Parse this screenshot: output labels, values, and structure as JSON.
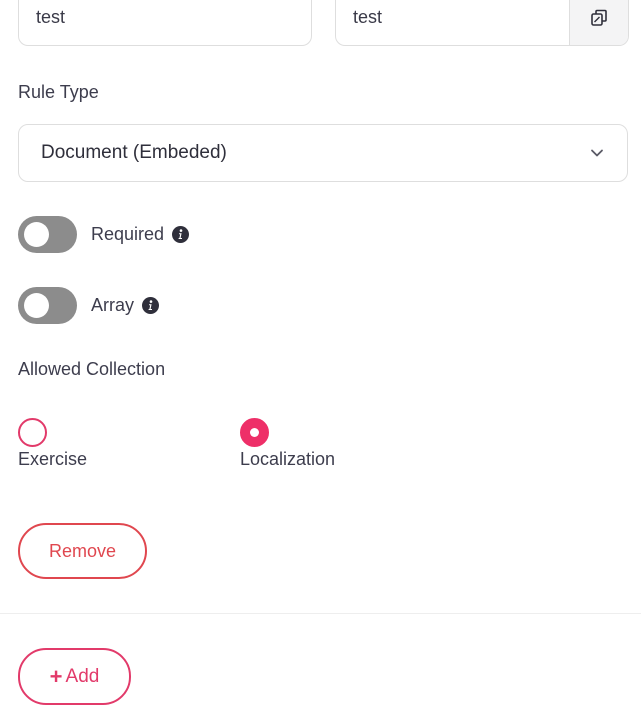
{
  "fields": {
    "left_value": "test",
    "right_value": "test"
  },
  "rule_type": {
    "label": "Rule Type",
    "selected": "Document (Embeded)"
  },
  "toggles": {
    "required": {
      "label": "Required",
      "enabled": false
    },
    "array": {
      "label": "Array",
      "enabled": false
    }
  },
  "allowed_collection": {
    "label": "Allowed Collection",
    "options": [
      {
        "label": "Exercise",
        "checked": false
      },
      {
        "label": "Localization",
        "checked": true
      }
    ]
  },
  "actions": {
    "remove_label": "Remove",
    "add_icon": "+",
    "add_label": "Add"
  },
  "colors": {
    "accent": "#ee2f68",
    "remove": "#e0474f",
    "toggle_off": "#8c8c8c"
  },
  "icons": {
    "copy": "copy-icon",
    "chevron": "chevron-down-icon",
    "info": "info-icon"
  }
}
